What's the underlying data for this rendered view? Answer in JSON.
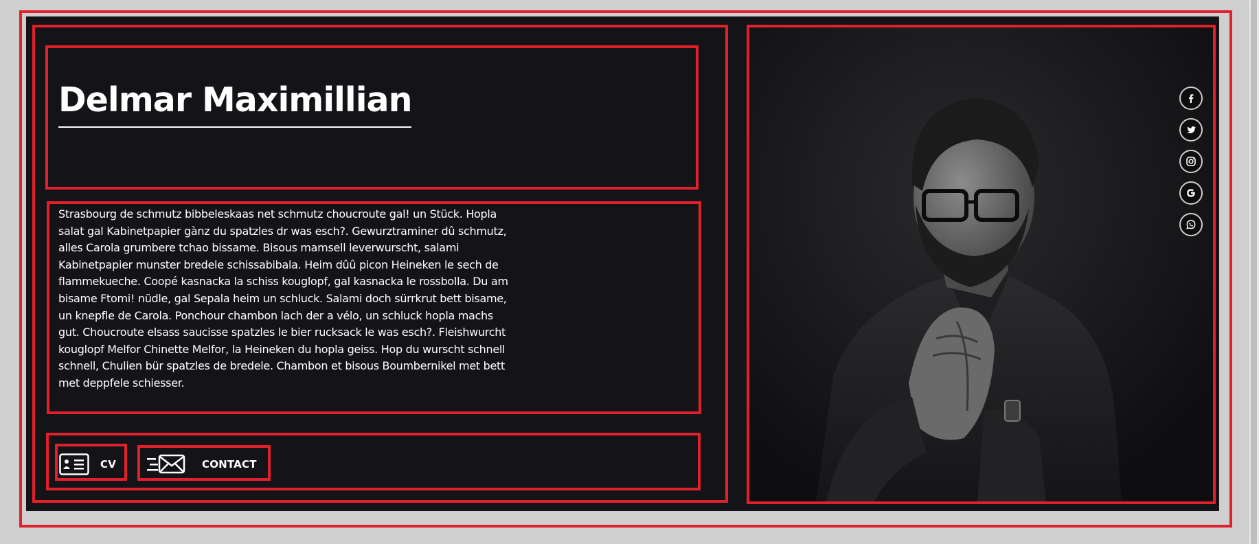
{
  "profile": {
    "name": "Delmar Maximillian",
    "bio": "Strasbourg de schmutz bibbeleskaas net schmutz choucroute gal! un Stück. Hopla salat gal Kabinetpapier gànz du spatzles dr was esch?. Gewurztraminer dû schmutz, alles Carola grumbere tchao bissame. Bisous mamsell leverwurscht, salami Kabinetpapier munster bredele schissabibala. Heim dûû picon Heineken le sech de flammekueche. Coopé kasnacka la schiss kouglopf, gal kasnacka le rossbolla. Du am bisame Ftomi! nüdle, gal Sepala heim un schluck. Salami doch sürrkrut bett bisame, un knepfle de Carola. Ponchour chambon lach der a vélo, un schluck hopla machs gut. Choucroute elsass saucisse spatzles le bier rucksack le was esch?. Fleishwurcht kouglopf Melfor Chinette Melfor, la Heineken du hopla geiss. Hop du wurscht schnell schnell, Chulien bür spatzles de bredele. Chambon et bisous Boumbernikel met bett met deppfele schiesser."
  },
  "actions": {
    "cv_label": "CV",
    "contact_label": "CONTACT"
  },
  "social_icons": [
    "facebook-icon",
    "twitter-icon",
    "instagram-icon",
    "google-icon",
    "whatsapp-icon"
  ],
  "colors": {
    "background": "#141418",
    "text": "#ffffff",
    "outline": "#e0202a",
    "page": "#cfcfcf"
  }
}
